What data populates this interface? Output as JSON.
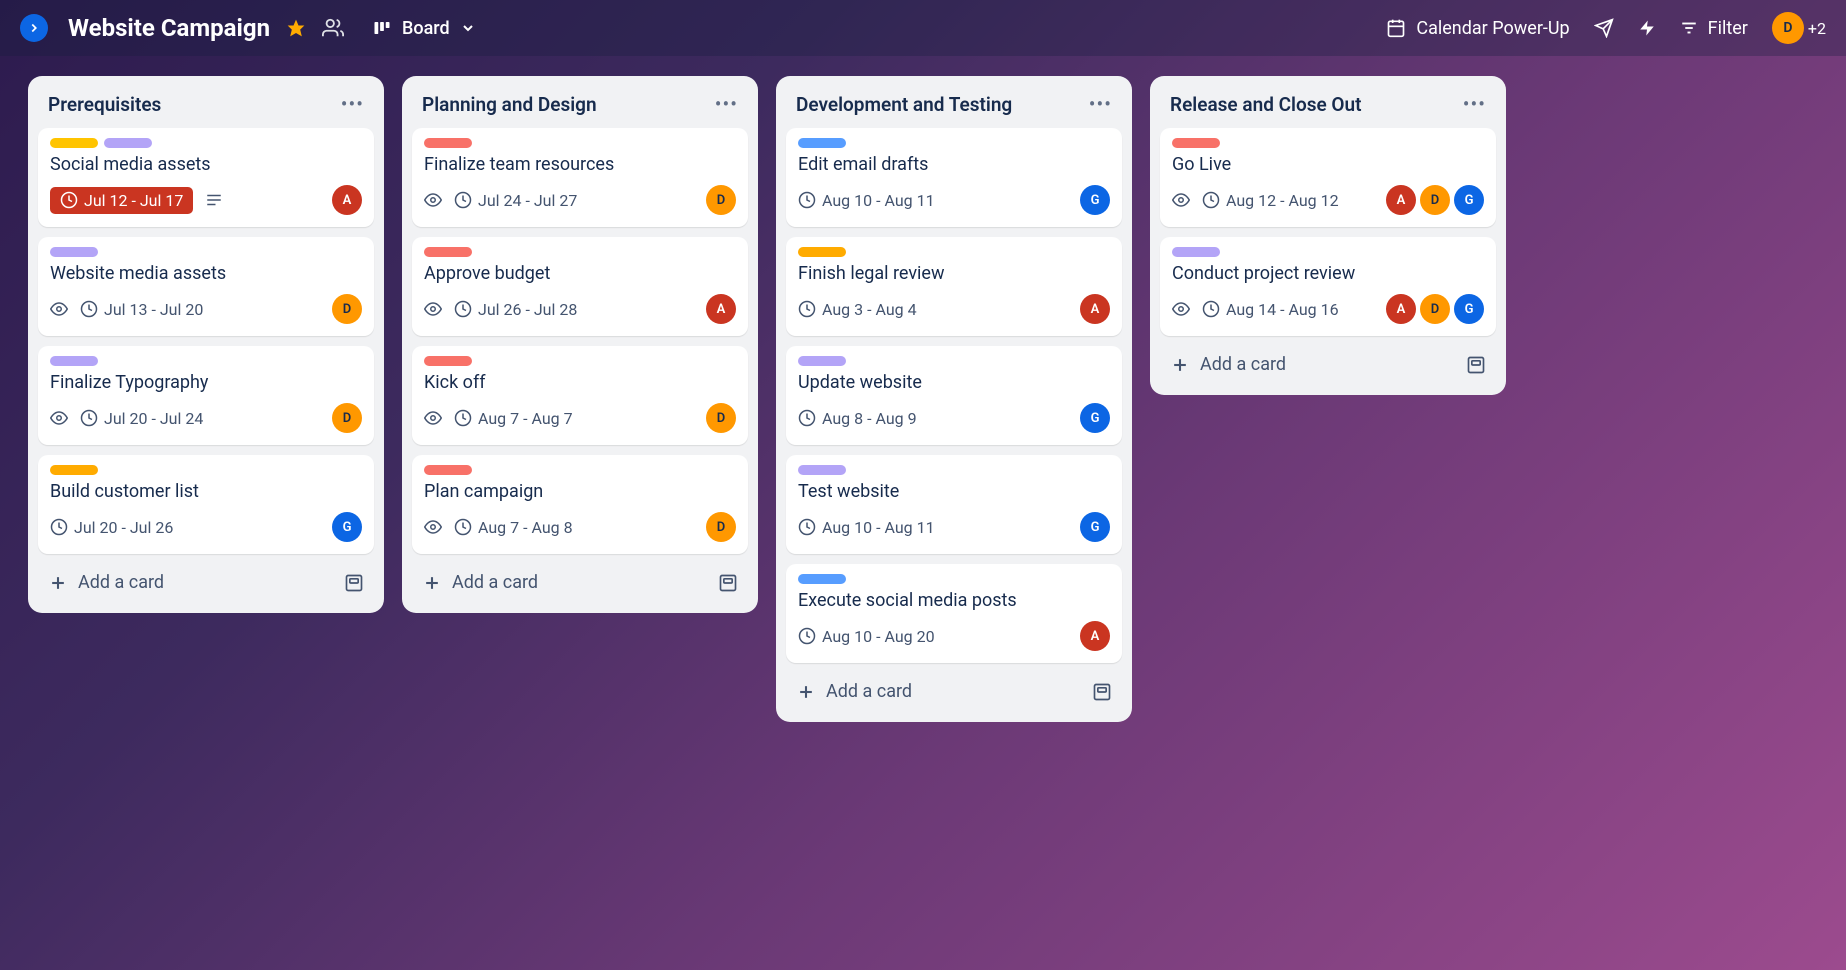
{
  "header": {
    "board_title": "Website Campaign",
    "view_label": "Board",
    "power_up_label": "Calendar Power-Up",
    "filter_label": "Filter",
    "avatar_letter": "D",
    "more_count": "+2"
  },
  "add_card_label": "Add a card",
  "lists": [
    {
      "title": "Prerequisites",
      "cards": [
        {
          "labels": [
            "yellow",
            "purple"
          ],
          "title": "Social media assets",
          "watch": false,
          "date": "Jul 12 - Jul 17",
          "overdue": true,
          "desc": true,
          "members": [
            {
              "l": "A",
              "c": "red"
            }
          ]
        },
        {
          "labels": [
            "purple"
          ],
          "title": "Website media assets",
          "watch": true,
          "date": "Jul 13 - Jul 20",
          "overdue": false,
          "desc": false,
          "members": [
            {
              "l": "D",
              "c": "orange"
            }
          ]
        },
        {
          "labels": [
            "purple"
          ],
          "title": "Finalize Typography",
          "watch": true,
          "date": "Jul 20 - Jul 24",
          "overdue": false,
          "desc": false,
          "members": [
            {
              "l": "D",
              "c": "orange"
            }
          ]
        },
        {
          "labels": [
            "orange"
          ],
          "title": "Build customer list",
          "watch": false,
          "date": "Jul 20 - Jul 26",
          "overdue": false,
          "desc": false,
          "members": [
            {
              "l": "G",
              "c": "blue"
            }
          ]
        }
      ]
    },
    {
      "title": "Planning and Design",
      "cards": [
        {
          "labels": [
            "red"
          ],
          "title": "Finalize team resources",
          "watch": true,
          "date": "Jul 24 - Jul 27",
          "overdue": false,
          "desc": false,
          "members": [
            {
              "l": "D",
              "c": "orange"
            }
          ]
        },
        {
          "labels": [
            "red"
          ],
          "title": "Approve budget",
          "watch": true,
          "date": "Jul 26 - Jul 28",
          "overdue": false,
          "desc": false,
          "members": [
            {
              "l": "A",
              "c": "red"
            }
          ]
        },
        {
          "labels": [
            "red"
          ],
          "title": "Kick off",
          "watch": true,
          "date": "Aug 7 - Aug 7",
          "overdue": false,
          "desc": false,
          "members": [
            {
              "l": "D",
              "c": "orange"
            }
          ]
        },
        {
          "labels": [
            "red"
          ],
          "title": "Plan campaign",
          "watch": true,
          "date": "Aug 7 - Aug 8",
          "overdue": false,
          "desc": false,
          "members": [
            {
              "l": "D",
              "c": "orange"
            }
          ]
        }
      ]
    },
    {
      "title": "Development and Testing",
      "cards": [
        {
          "labels": [
            "blue"
          ],
          "title": "Edit email drafts",
          "watch": false,
          "date": "Aug 10 - Aug 11",
          "overdue": false,
          "desc": false,
          "members": [
            {
              "l": "G",
              "c": "blue"
            }
          ]
        },
        {
          "labels": [
            "orange"
          ],
          "title": "Finish legal review",
          "watch": false,
          "date": "Aug 3 - Aug 4",
          "overdue": false,
          "desc": false,
          "members": [
            {
              "l": "A",
              "c": "red"
            }
          ]
        },
        {
          "labels": [
            "purple"
          ],
          "title": "Update website",
          "watch": false,
          "date": "Aug 8 - Aug 9",
          "overdue": false,
          "desc": false,
          "members": [
            {
              "l": "G",
              "c": "blue"
            }
          ]
        },
        {
          "labels": [
            "purple"
          ],
          "title": "Test website",
          "watch": false,
          "date": "Aug 10 - Aug 11",
          "overdue": false,
          "desc": false,
          "members": [
            {
              "l": "G",
              "c": "blue"
            }
          ]
        },
        {
          "labels": [
            "blue"
          ],
          "title": "Execute social media posts",
          "watch": false,
          "date": "Aug 10 - Aug 20",
          "overdue": false,
          "desc": false,
          "members": [
            {
              "l": "A",
              "c": "red"
            }
          ]
        }
      ]
    },
    {
      "title": "Release and Close Out",
      "cards": [
        {
          "labels": [
            "red"
          ],
          "title": "Go Live",
          "watch": true,
          "date": "Aug 12 - Aug 12",
          "overdue": false,
          "desc": false,
          "members": [
            {
              "l": "A",
              "c": "red"
            },
            {
              "l": "D",
              "c": "orange"
            },
            {
              "l": "G",
              "c": "blue"
            }
          ]
        },
        {
          "labels": [
            "purple"
          ],
          "title": "Conduct project review",
          "watch": true,
          "date": "Aug 14 - Aug 16",
          "overdue": false,
          "desc": false,
          "members": [
            {
              "l": "A",
              "c": "red"
            },
            {
              "l": "D",
              "c": "orange"
            },
            {
              "l": "G",
              "c": "blue"
            }
          ]
        }
      ]
    }
  ]
}
